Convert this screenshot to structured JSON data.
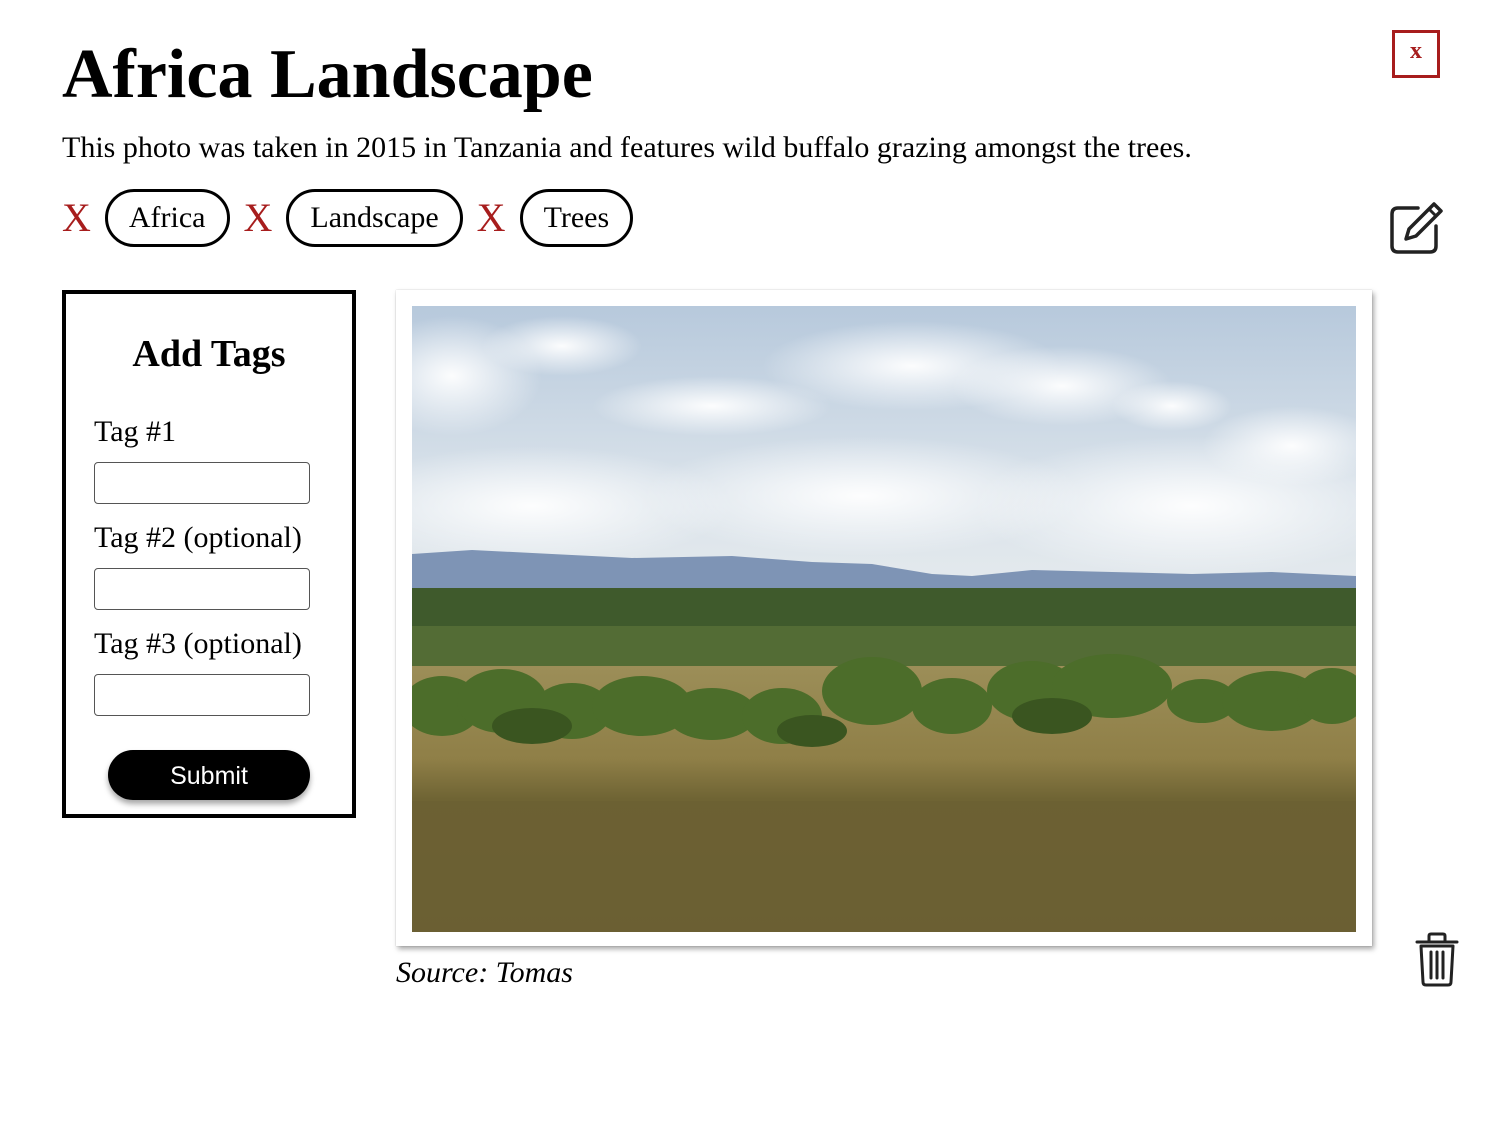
{
  "header": {
    "title": "Africa Landscape",
    "close_label": "x"
  },
  "description": "This photo was taken in 2015 in Tanzania and features wild buffalo grazing amongst the trees.",
  "tags": [
    {
      "remove_label": "X",
      "label": "Africa"
    },
    {
      "remove_label": "X",
      "label": "Landscape"
    },
    {
      "remove_label": "X",
      "label": "Trees"
    }
  ],
  "add_tags": {
    "title": "Add Tags",
    "fields": [
      {
        "label": "Tag #1",
        "value": ""
      },
      {
        "label": "Tag #2 (optional)",
        "value": ""
      },
      {
        "label": "Tag #3 (optional)",
        "value": ""
      }
    ],
    "submit_label": "Submit"
  },
  "photo": {
    "caption": "Source: Tomas"
  },
  "icons": {
    "edit": "edit-icon",
    "delete": "trash-icon"
  },
  "colors": {
    "accent_red": "#a71d1d",
    "button_black": "#000000"
  }
}
